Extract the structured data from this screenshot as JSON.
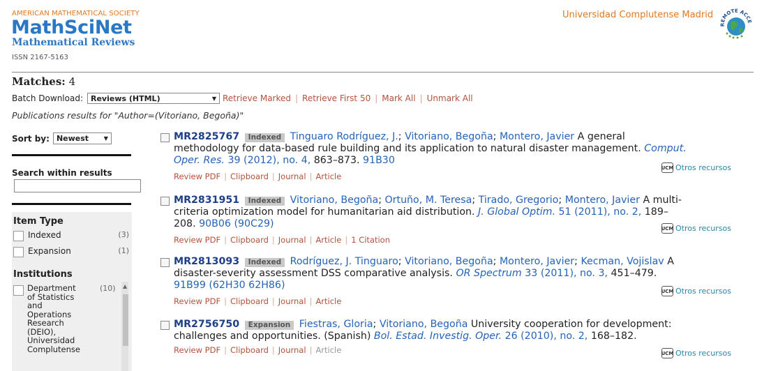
{
  "header": {
    "society": "AMERICAN MATHEMATICAL SOCIETY",
    "brand": "MathSciNet",
    "subtitle": "Mathematical Reviews",
    "issn": "ISSN 2167-5163",
    "institution": "Universidad Complutense Madrid",
    "remote_badge": "REMOTE ACCESS"
  },
  "matches": {
    "label": "Matches:",
    "count": "4"
  },
  "batch": {
    "label": "Batch Download:",
    "selected": "Reviews (HTML)",
    "links": [
      "Retrieve Marked",
      "Retrieve First 50",
      "Mark All",
      "Unmark All"
    ]
  },
  "publications_query": "Publications results for \"Author=(Vitoriano, Begoña)\"",
  "sidebar": {
    "sort_label": "Sort by:",
    "sort_selected": "Newest",
    "search_within": "Search within results",
    "item_type_title": "Item Type",
    "item_types": [
      {
        "label": "Indexed",
        "count": "(3)"
      },
      {
        "label": "Expansion",
        "count": "(1)"
      }
    ],
    "institutions_title": "Institutions",
    "institution_item": {
      "label": "Department of Statistics and Operations Research (DEIO), Universidad Complutense",
      "count": "(10)"
    }
  },
  "results": [
    {
      "mr": "MR2825767",
      "status": "Indexed",
      "authors": [
        "Tinguaro Rodríguez, J.",
        "Vitoriano, Begoña",
        "Montero, Javier"
      ],
      "title_pre": "A general",
      "title_line2": "methodology for data-based rule building and its application to natural disaster management.",
      "journal": "Comput. Oper. Res.",
      "journal_line1": "Comput.",
      "journal_line2": "Oper. Res.",
      "volinfo": "39 (2012), no. 4,",
      "pages": "863–873.",
      "msc": "91B30",
      "links": [
        "Review PDF",
        "Clipboard",
        "Journal",
        "Article"
      ],
      "otros": "Otros recursos"
    },
    {
      "mr": "MR2831951",
      "status": "Indexed",
      "authors": [
        "Vitoriano, Begoña",
        "Ortuño, M. Teresa",
        "Tirado, Gregorio",
        "Montero, Javier"
      ],
      "title_pre": "A multi-",
      "title_line2": "criteria optimization model for humanitarian aid distribution.",
      "journal": "J. Global Optim.",
      "volinfo": "51 (2011), no. 2,",
      "pages_a": "189–",
      "pages_b": "208.",
      "msc": "90B06 (90C29)",
      "links": [
        "Review PDF",
        "Clipboard",
        "Journal",
        "Article",
        "1 Citation"
      ],
      "otros": "Otros recursos"
    },
    {
      "mr": "MR2813093",
      "status": "Indexed",
      "authors": [
        "Rodríguez, J. Tinguaro",
        "Vitoriano, Begoña",
        "Montero, Javier",
        "Kecman, Vojislav"
      ],
      "title_pre": "A",
      "title_line2": "disaster-severity assessment DSS comparative analysis.",
      "journal": "OR Spectrum",
      "volinfo": "33 (2011), no. 3,",
      "pages": "451–479.",
      "msc": "91B99 (62H30 62H86)",
      "links": [
        "Review PDF",
        "Clipboard",
        "Journal",
        "Article"
      ],
      "otros": "Otros recursos"
    },
    {
      "mr": "MR2756750",
      "status": "Expansion",
      "authors": [
        "Fiestras, Gloria",
        "Vitoriano, Begoña"
      ],
      "title_pre": "University cooperation for development:",
      "title_line2": "challenges and opportunities. (Spanish)",
      "journal": "Bol. Estad. Investig. Oper.",
      "volinfo": "26 (2010), no. 2,",
      "pages": "168–182.",
      "links": [
        "Review PDF",
        "Clipboard",
        "Journal",
        "Article"
      ],
      "otros": "Otros recursos"
    }
  ],
  "ucm_logo": "UCM"
}
